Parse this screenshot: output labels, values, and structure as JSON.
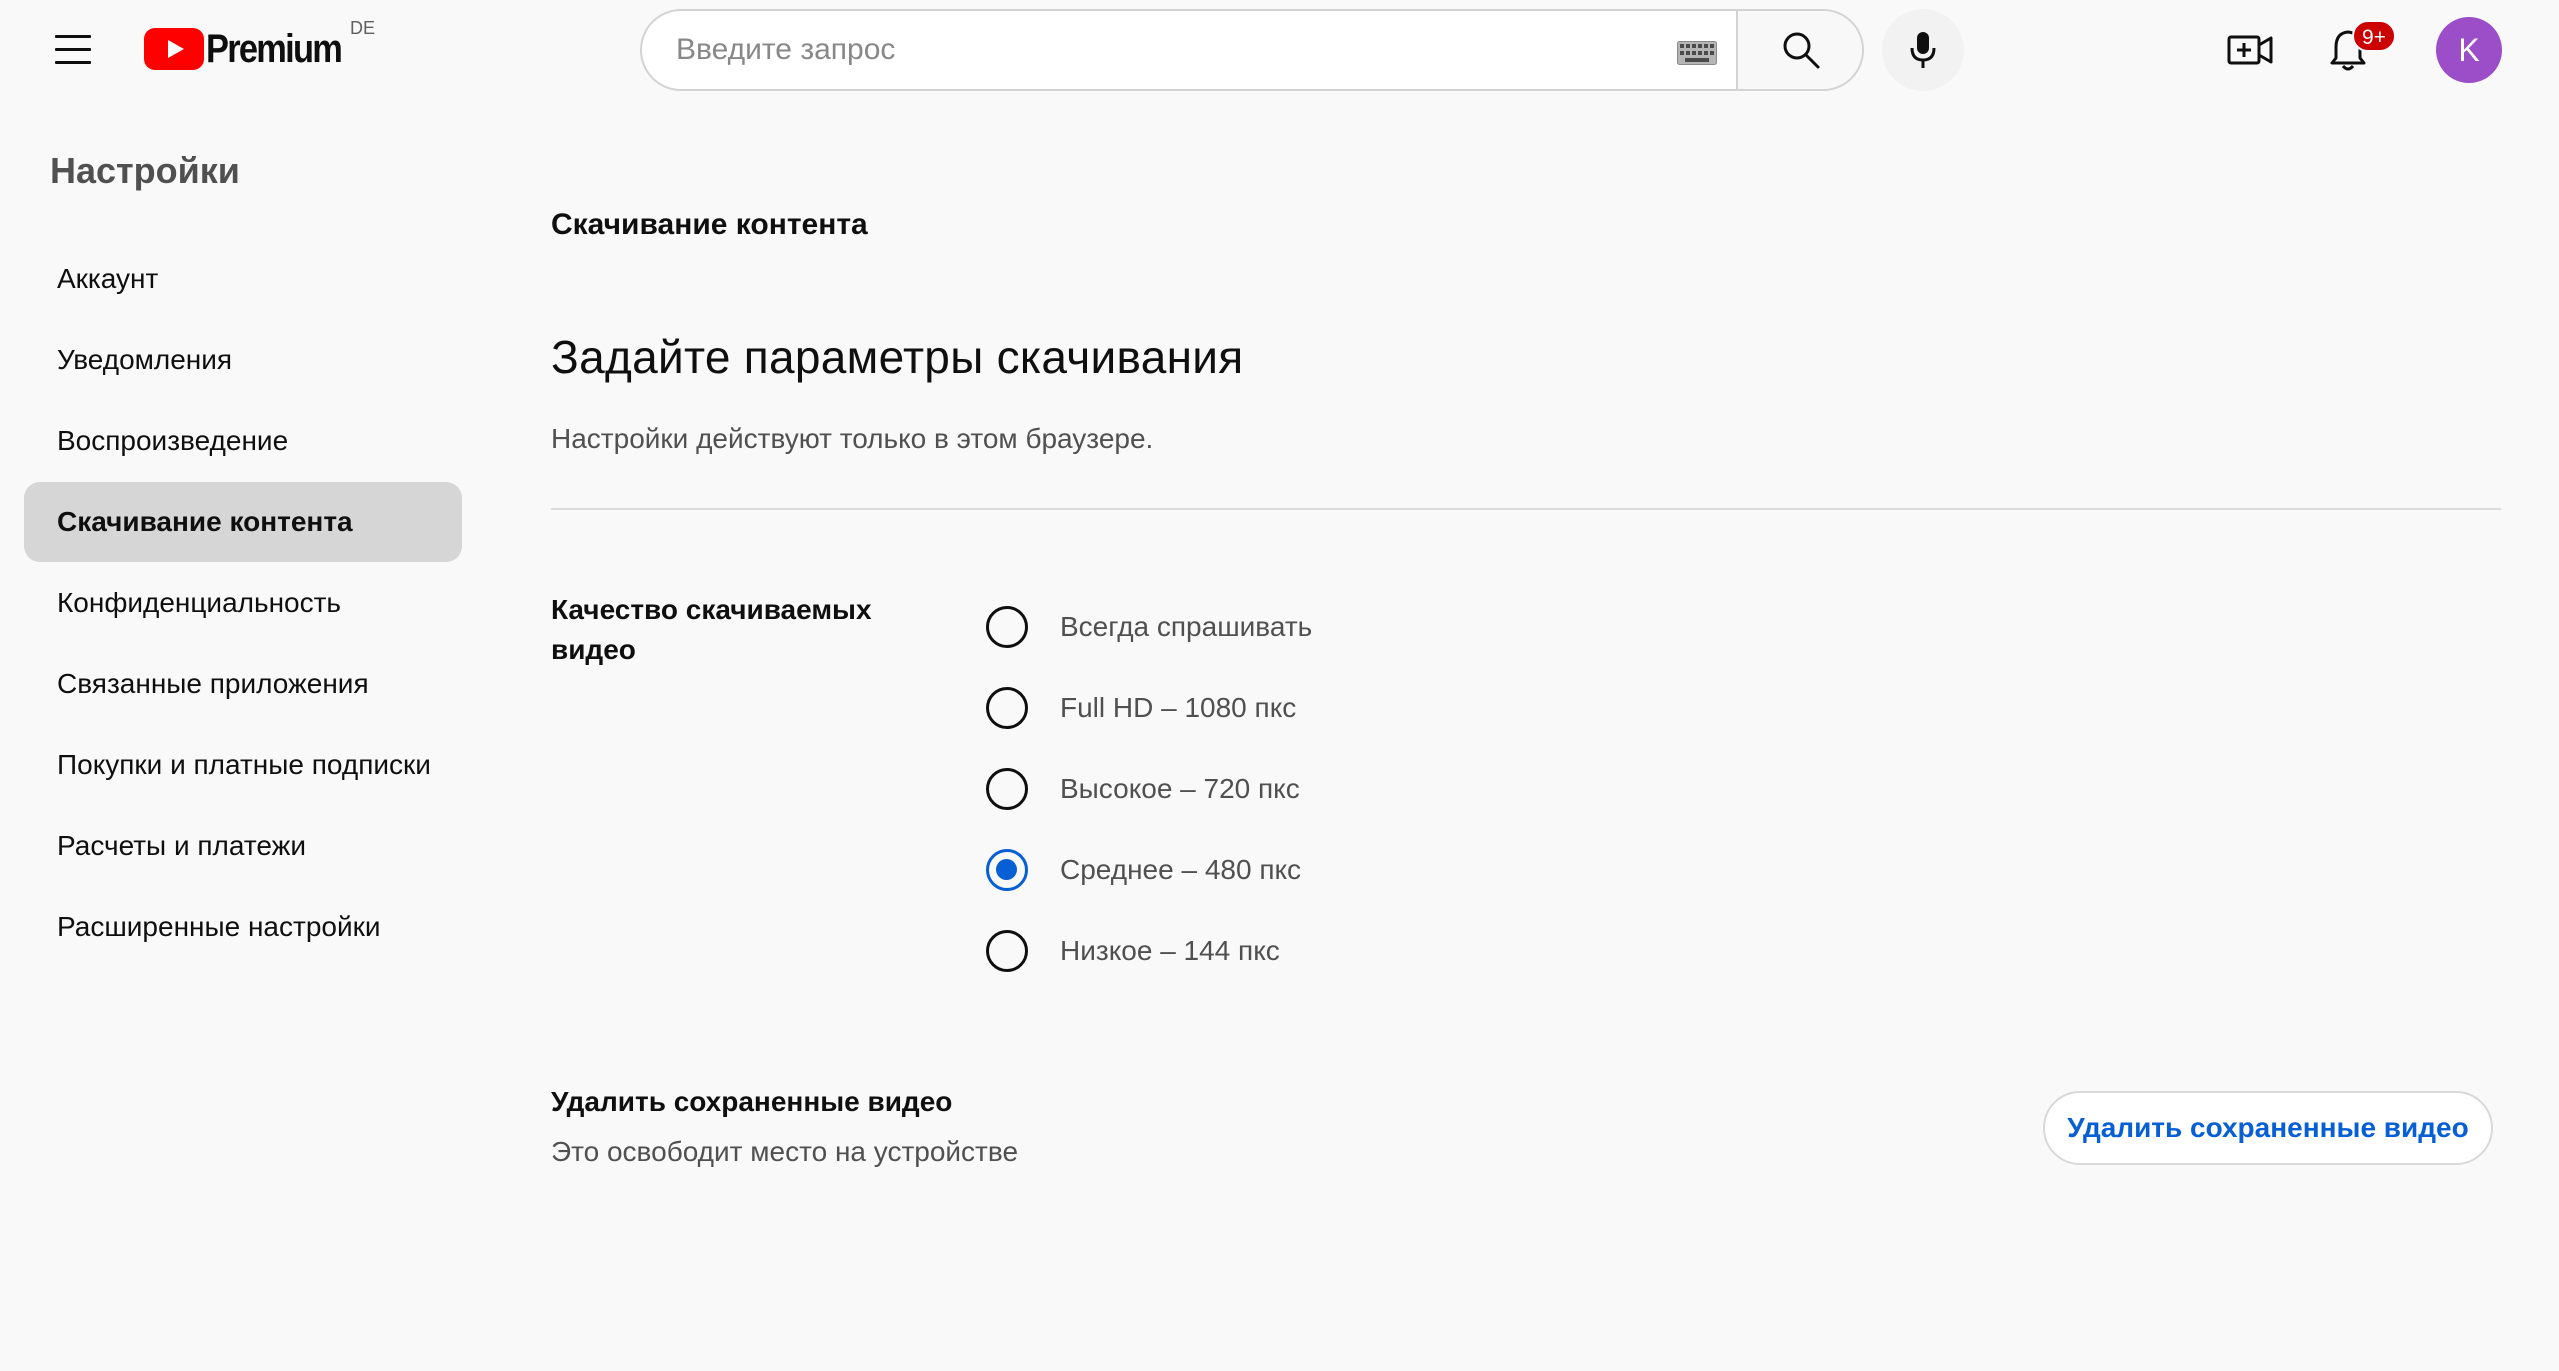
{
  "header": {
    "logo_text": "Premium",
    "country_code": "DE",
    "search_placeholder": "Введите запрос",
    "notification_badge": "9+",
    "avatar_letter": "K",
    "brand_color": "#ff0000",
    "avatar_color": "#9c4ec8"
  },
  "sidebar": {
    "title": "Настройки",
    "items": [
      {
        "label": "Аккаунт",
        "active": false
      },
      {
        "label": "Уведомления",
        "active": false
      },
      {
        "label": "Воспроизведение",
        "active": false
      },
      {
        "label": "Скачивание контента",
        "active": true
      },
      {
        "label": "Конфиденциальность",
        "active": false
      },
      {
        "label": "Связанные приложения",
        "active": false
      },
      {
        "label": "Покупки и платные подписки",
        "active": false
      },
      {
        "label": "Расчеты и платежи",
        "active": false
      },
      {
        "label": "Расширенные настройки",
        "active": false
      }
    ]
  },
  "main": {
    "section_label": "Скачивание контента",
    "heading": "Задайте параметры скачивания",
    "description": "Настройки действуют только в этом браузере.",
    "quality": {
      "label": "Качество скачиваемых видео",
      "options": [
        {
          "label": "Всегда спрашивать",
          "selected": false
        },
        {
          "label": "Full HD – 1080 пкс",
          "selected": false
        },
        {
          "label": "Высокое – 720 пкс",
          "selected": false
        },
        {
          "label": "Среднее – 480 пкс",
          "selected": true
        },
        {
          "label": "Низкое – 144 пкс",
          "selected": false
        }
      ]
    },
    "delete_saved": {
      "title": "Удалить сохраненные видео",
      "description": "Это освободит место на устройстве",
      "button_label": "Удалить сохраненные видео"
    },
    "accent_color": "#065fd4"
  }
}
